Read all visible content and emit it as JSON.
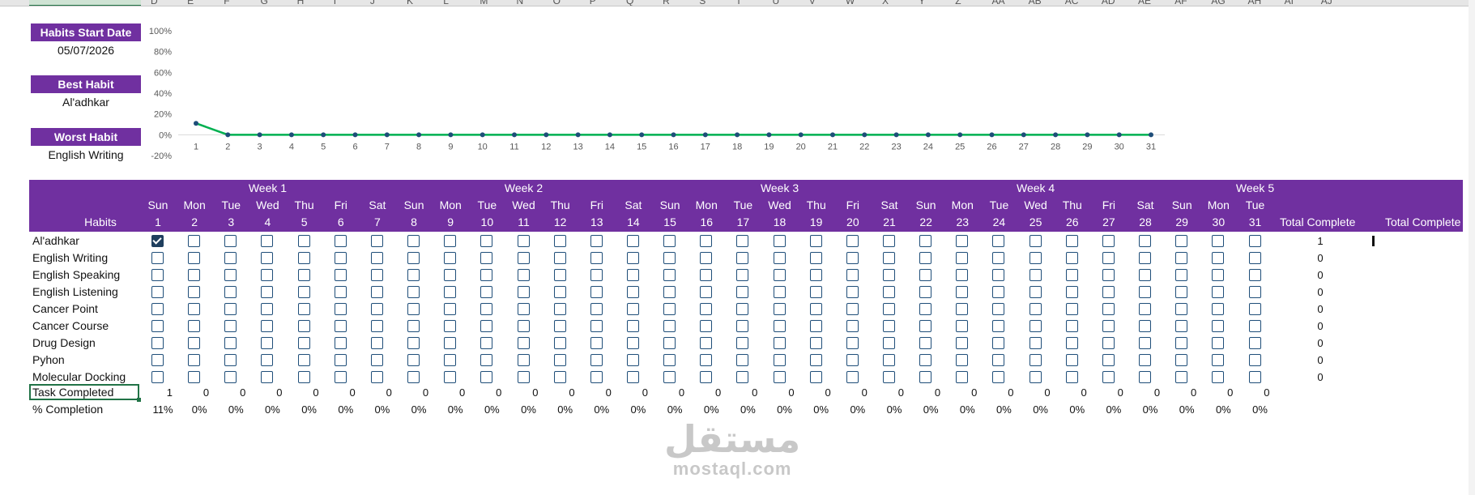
{
  "column_letters": [
    "D",
    "E",
    "F",
    "G",
    "H",
    "I",
    "J",
    "K",
    "L",
    "M",
    "N",
    "O",
    "P",
    "Q",
    "R",
    "S",
    "T",
    "U",
    "V",
    "W",
    "X",
    "Y",
    "Z",
    "AA",
    "AB",
    "AC",
    "AD",
    "AE",
    "AF",
    "AG",
    "AH",
    "AI",
    "AJ"
  ],
  "summary": {
    "start_label": "Habits Start Date",
    "start_value": "05/07/2026",
    "best_label": "Best Habit",
    "best_value": "Al'adhkar",
    "worst_label": "Worst Habit",
    "worst_value": "English Writing"
  },
  "chart_data": {
    "type": "line",
    "x": [
      1,
      2,
      3,
      4,
      5,
      6,
      7,
      8,
      9,
      10,
      11,
      12,
      13,
      14,
      15,
      16,
      17,
      18,
      19,
      20,
      21,
      22,
      23,
      24,
      25,
      26,
      27,
      28,
      29,
      30,
      31
    ],
    "series": [
      {
        "values": [
          0.11,
          0,
          0,
          0,
          0,
          0,
          0,
          0,
          0,
          0,
          0,
          0,
          0,
          0,
          0,
          0,
          0,
          0,
          0,
          0,
          0,
          0,
          0,
          0,
          0,
          0,
          0,
          0,
          0,
          0,
          0
        ]
      }
    ],
    "y_ticks": [
      "100%",
      "80%",
      "60%",
      "40%",
      "20%",
      "0%",
      "-20%"
    ],
    "ylim": [
      -0.2,
      1.0
    ],
    "line_color": "#00b050",
    "marker_color": "#1f4e79",
    "grid": false
  },
  "weeks": [
    "Week 1",
    "Week 2",
    "Week 3",
    "Week 4",
    "Week 5"
  ],
  "days": [
    {
      "dow": "Sun",
      "num": "1"
    },
    {
      "dow": "Mon",
      "num": "2"
    },
    {
      "dow": "Tue",
      "num": "3"
    },
    {
      "dow": "Wed",
      "num": "4"
    },
    {
      "dow": "Thu",
      "num": "5"
    },
    {
      "dow": "Fri",
      "num": "6"
    },
    {
      "dow": "Sat",
      "num": "7"
    },
    {
      "dow": "Sun",
      "num": "8"
    },
    {
      "dow": "Mon",
      "num": "9"
    },
    {
      "dow": "Tue",
      "num": "10"
    },
    {
      "dow": "Wed",
      "num": "11"
    },
    {
      "dow": "Thu",
      "num": "12"
    },
    {
      "dow": "Fri",
      "num": "13"
    },
    {
      "dow": "Sat",
      "num": "14"
    },
    {
      "dow": "Sun",
      "num": "15"
    },
    {
      "dow": "Mon",
      "num": "16"
    },
    {
      "dow": "Tue",
      "num": "17"
    },
    {
      "dow": "Wed",
      "num": "18"
    },
    {
      "dow": "Thu",
      "num": "19"
    },
    {
      "dow": "Fri",
      "num": "20"
    },
    {
      "dow": "Sat",
      "num": "21"
    },
    {
      "dow": "Sun",
      "num": "22"
    },
    {
      "dow": "Mon",
      "num": "23"
    },
    {
      "dow": "Tue",
      "num": "24"
    },
    {
      "dow": "Wed",
      "num": "25"
    },
    {
      "dow": "Thu",
      "num": "26"
    },
    {
      "dow": "Fri",
      "num": "27"
    },
    {
      "dow": "Sat",
      "num": "28"
    },
    {
      "dow": "Sun",
      "num": "29"
    },
    {
      "dow": "Mon",
      "num": "30"
    },
    {
      "dow": "Tue",
      "num": "31"
    }
  ],
  "table": {
    "habits_header": "Habits",
    "total_header": "Total Complete",
    "total_header2": "Total Complete",
    "habits": [
      {
        "name": "Al'adhkar",
        "checked_days": [
          1
        ],
        "total": "1"
      },
      {
        "name": "English Writing",
        "checked_days": [],
        "total": "0"
      },
      {
        "name": "English Speaking",
        "checked_days": [],
        "total": "0"
      },
      {
        "name": "English Listening",
        "checked_days": [],
        "total": "0"
      },
      {
        "name": "Cancer Point",
        "checked_days": [],
        "total": "0"
      },
      {
        "name": "Cancer Course",
        "checked_days": [],
        "total": "0"
      },
      {
        "name": "Drug Design",
        "checked_days": [],
        "total": "0"
      },
      {
        "name": "Pyhon",
        "checked_days": [],
        "total": "0"
      },
      {
        "name": "Molecular Docking",
        "checked_days": [],
        "total": "0"
      }
    ],
    "task_label": "Task Completed",
    "task_counts": [
      "1",
      "0",
      "0",
      "0",
      "0",
      "0",
      "0",
      "0",
      "0",
      "0",
      "0",
      "0",
      "0",
      "0",
      "0",
      "0",
      "0",
      "0",
      "0",
      "0",
      "0",
      "0",
      "0",
      "0",
      "0",
      "0",
      "0",
      "0",
      "0",
      "0",
      "0"
    ],
    "pct_label": "% Completion",
    "pct_values": [
      "11%",
      "0%",
      "0%",
      "0%",
      "0%",
      "0%",
      "0%",
      "0%",
      "0%",
      "0%",
      "0%",
      "0%",
      "0%",
      "0%",
      "0%",
      "0%",
      "0%",
      "0%",
      "0%",
      "0%",
      "0%",
      "0%",
      "0%",
      "0%",
      "0%",
      "0%",
      "0%",
      "0%",
      "0%",
      "0%",
      "0%"
    ]
  },
  "watermark": {
    "arabic": "مستقل",
    "latin": "mostaql.com"
  }
}
